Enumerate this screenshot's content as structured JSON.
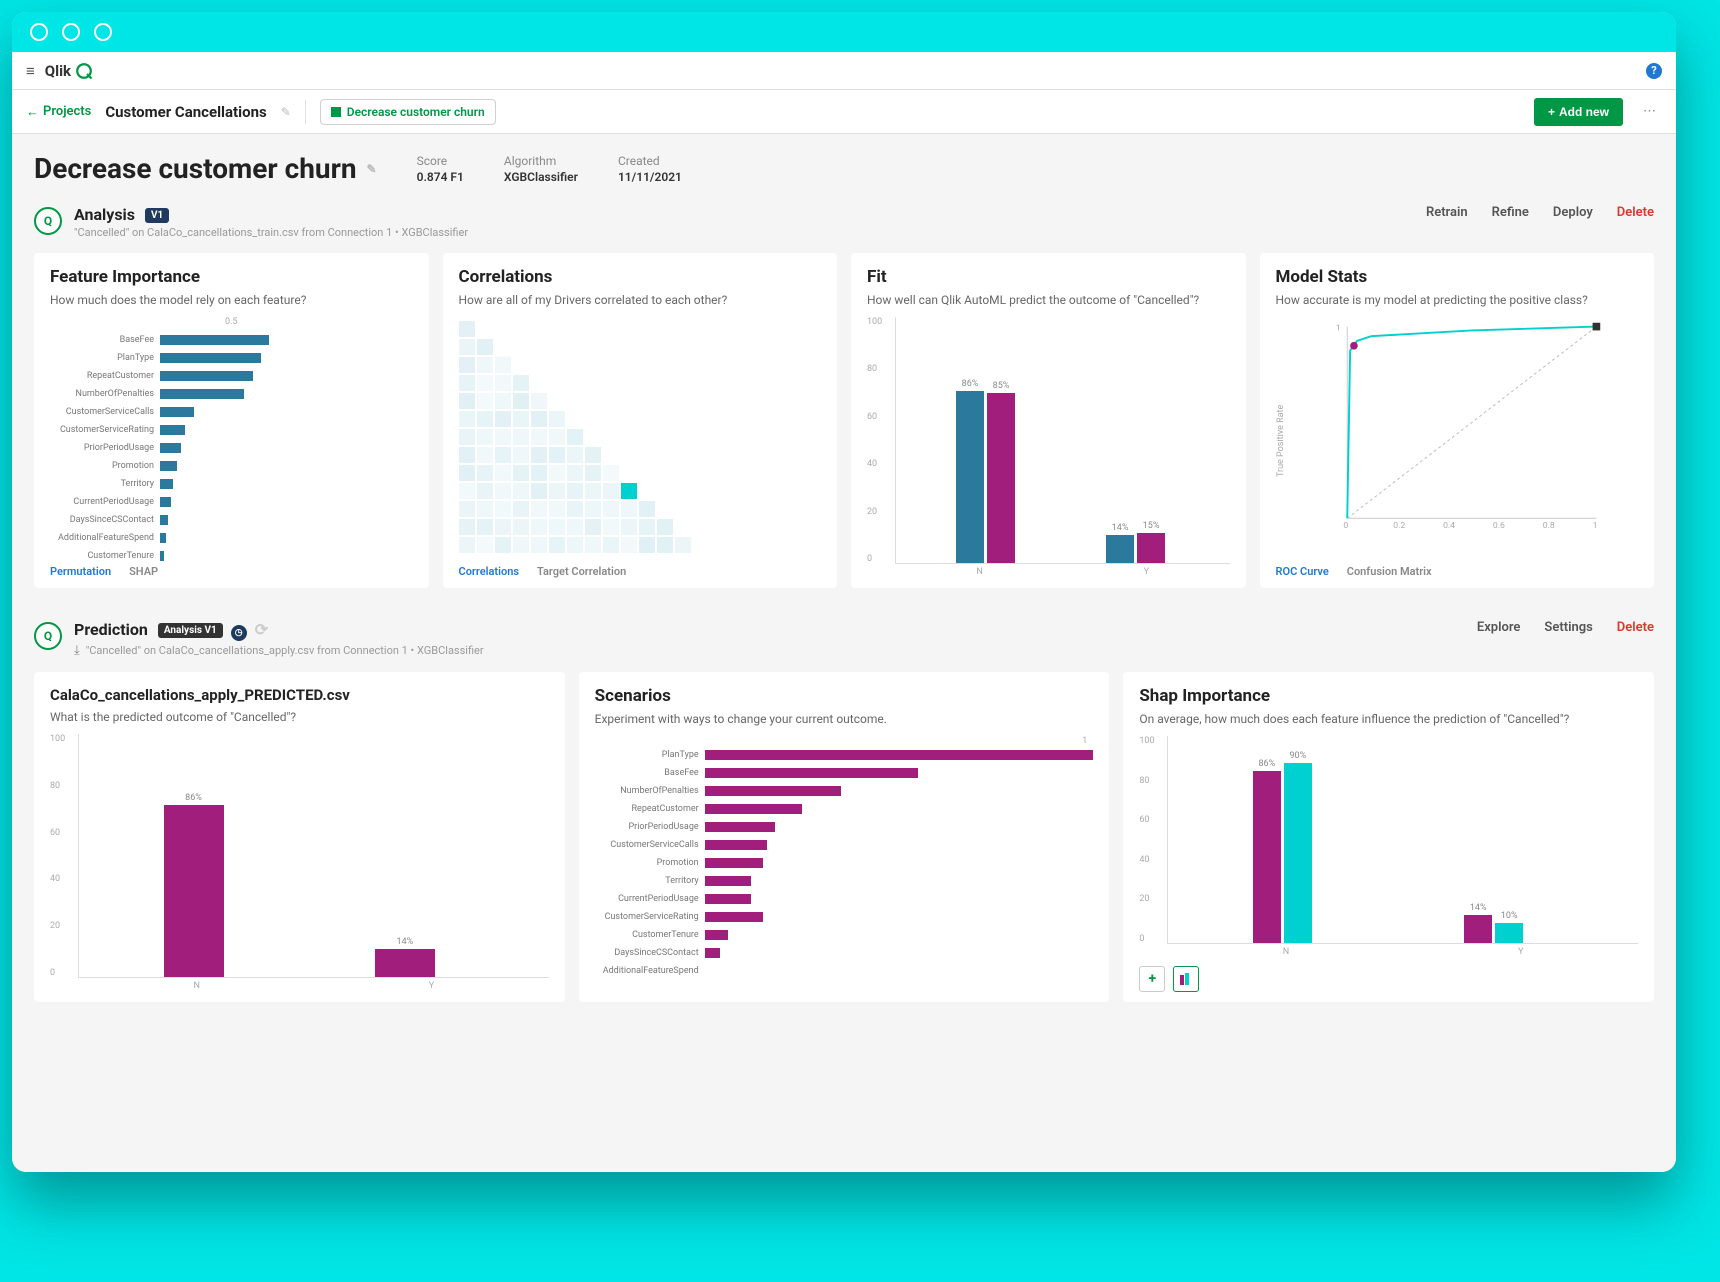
{
  "topbar": {
    "logo": "Qlik"
  },
  "subbar": {
    "back_label": "Projects",
    "breadcrumb": "Customer Cancellations",
    "chip_label": "Decrease customer churn",
    "add_label": "Add new"
  },
  "page": {
    "title": "Decrease customer churn",
    "meta": {
      "score_label": "Score",
      "score": "0.874 F1",
      "algo_label": "Algorithm",
      "algo": "XGBClassifier",
      "created_label": "Created",
      "created": "11/11/2021"
    }
  },
  "analysis": {
    "title": "Analysis",
    "version": "V1",
    "sub": "\"Cancelled\" on CalaCo_cancellations_train.csv from Connection 1  •  XGBClassifier",
    "actions": {
      "retrain": "Retrain",
      "refine": "Refine",
      "deploy": "Deploy",
      "delete": "Delete"
    }
  },
  "prediction": {
    "title": "Prediction",
    "version": "Analysis V1",
    "sub": "\"Cancelled\" on CalaCo_cancellations_apply.csv from Connection 1  •  XGBClassifier",
    "actions": {
      "explore": "Explore",
      "settings": "Settings",
      "delete": "Delete"
    }
  },
  "cards": {
    "feature_importance": {
      "title": "Feature Importance",
      "desc": "How much does the model rely on each feature?",
      "axis_tick": "0.5",
      "tabs": {
        "a": "Permutation",
        "b": "SHAP"
      }
    },
    "correlations": {
      "title": "Correlations",
      "desc": "How are all of my Drivers correlated to each other?",
      "tabs": {
        "a": "Correlations",
        "b": "Target Correlation"
      }
    },
    "fit": {
      "title": "Fit",
      "desc": "How well can Qlik AutoML predict the outcome of \"Cancelled\"?"
    },
    "model_stats": {
      "title": "Model Stats",
      "desc": "How accurate is my model at predicting the positive class?",
      "ylabel": "True Positive Rate",
      "tabs": {
        "a": "ROC Curve",
        "b": "Confusion Matrix"
      }
    },
    "predicted": {
      "title": "CalaCo_cancellations_apply_PREDICTED.csv",
      "desc": "What is the predicted outcome of \"Cancelled\"?"
    },
    "scenarios": {
      "title": "Scenarios",
      "desc": "Experiment with ways to change your current outcome.",
      "axis_tick": "1"
    },
    "shap": {
      "title": "Shap Importance",
      "desc": "On average, how much does each feature influence the prediction of \"Cancelled\"?"
    }
  },
  "chart_data": [
    {
      "id": "feature_importance",
      "type": "bar",
      "orientation": "horizontal",
      "xlim": [
        0,
        0.6
      ],
      "categories": [
        "BaseFee",
        "PlanType",
        "RepeatCustomer",
        "NumberOfPenalties",
        "CustomerServiceCalls",
        "CustomerServiceRating",
        "PriorPeriodUsage",
        "Promotion",
        "Territory",
        "CurrentPeriodUsage",
        "DaysSinceCSContact",
        "AdditionalFeatureSpend",
        "CustomerTenure"
      ],
      "values": [
        0.26,
        0.24,
        0.22,
        0.2,
        0.08,
        0.06,
        0.05,
        0.04,
        0.03,
        0.025,
        0.02,
        0.015,
        0.01
      ]
    },
    {
      "id": "correlations",
      "type": "heatmap",
      "note": "13x13 correlation triangle; highlighted cell value ≈ high"
    },
    {
      "id": "fit",
      "type": "bar",
      "categories": [
        "N",
        "Y"
      ],
      "series": [
        {
          "name": "series1",
          "values": [
            86,
            14
          ]
        },
        {
          "name": "series2",
          "values": [
            85,
            15
          ]
        }
      ],
      "labels": {
        "N": [
          "86%",
          "85%"
        ],
        "Y": [
          "14%",
          "15%"
        ]
      },
      "ylim": [
        0,
        100
      ]
    },
    {
      "id": "model_stats_roc",
      "type": "line",
      "xlabel": "",
      "ylabel": "True Positive Rate",
      "xlim": [
        0,
        1
      ],
      "ylim": [
        0,
        1
      ],
      "series": [
        {
          "name": "ROC",
          "points": [
            [
              0,
              0
            ],
            [
              0.01,
              0.88
            ],
            [
              0.03,
              0.94
            ],
            [
              0.08,
              0.96
            ],
            [
              0.5,
              0.99
            ],
            [
              1,
              1
            ]
          ]
        },
        {
          "name": "diagonal",
          "points": [
            [
              0,
              0
            ],
            [
              1,
              1
            ]
          ]
        }
      ],
      "marker_point": [
        0.025,
        0.9
      ],
      "xticks": [
        0,
        0.2,
        0.4,
        0.6,
        0.8,
        1
      ]
    },
    {
      "id": "predicted",
      "type": "bar",
      "categories": [
        "N",
        "Y"
      ],
      "values": [
        86,
        14
      ],
      "labels": [
        "86%",
        "14%"
      ],
      "ylim": [
        0,
        100
      ]
    },
    {
      "id": "scenarios",
      "type": "bar",
      "orientation": "horizontal",
      "xlim": [
        0,
        1
      ],
      "categories": [
        "PlanType",
        "BaseFee",
        "NumberOfPenalties",
        "RepeatCustomer",
        "PriorPeriodUsage",
        "CustomerServiceCalls",
        "Promotion",
        "Territory",
        "CurrentPeriodUsage",
        "CustomerServiceRating",
        "CustomerTenure",
        "DaysSinceCSContact",
        "AdditionalFeatureSpend"
      ],
      "values": [
        1.0,
        0.55,
        0.35,
        0.25,
        0.18,
        0.16,
        0.15,
        0.12,
        0.12,
        0.15,
        0.06,
        0.04,
        0.0
      ]
    },
    {
      "id": "shap",
      "type": "bar",
      "categories": [
        "N",
        "Y"
      ],
      "series": [
        {
          "name": "series1",
          "values": [
            86,
            14
          ]
        },
        {
          "name": "series2",
          "values": [
            90,
            10
          ]
        }
      ],
      "labels": {
        "N": [
          "86%",
          "90%"
        ],
        "Y": [
          "14%",
          "10%"
        ]
      },
      "ylim": [
        0,
        100
      ]
    }
  ]
}
